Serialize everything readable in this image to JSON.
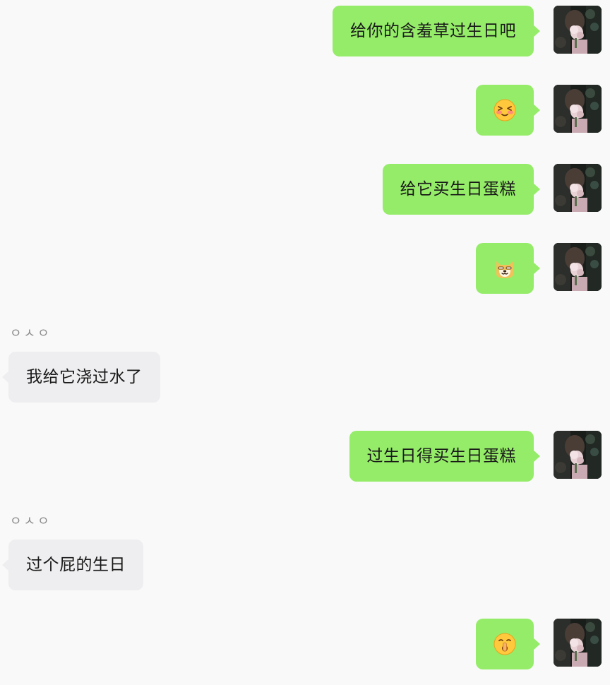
{
  "chat": {
    "messages": [
      {
        "side": "me",
        "type": "text",
        "text": "给你的含羞草过生日吧"
      },
      {
        "side": "me",
        "type": "emoji",
        "emoji": "shy-face-emoji"
      },
      {
        "side": "me",
        "type": "text",
        "text": "给它买生日蛋糕"
      },
      {
        "side": "me",
        "type": "emoji",
        "emoji": "doge-emoji"
      },
      {
        "side": "other",
        "type": "text",
        "sender": "ㅇㅅㅇ",
        "text": "我给它浇过水了"
      },
      {
        "side": "me",
        "type": "text",
        "text": "过生日得买生日蛋糕"
      },
      {
        "side": "other",
        "type": "text",
        "sender": "ㅇㅅㅇ",
        "text": "过个屁的生日"
      },
      {
        "side": "me",
        "type": "emoji",
        "emoji": "hush-finger-emoji"
      }
    ]
  },
  "colors": {
    "background": "#f9f9f9",
    "my_bubble": "#95ec69",
    "other_bubble": "#eeeef0",
    "text": "#191919",
    "sender_name": "#8a8a8a"
  }
}
